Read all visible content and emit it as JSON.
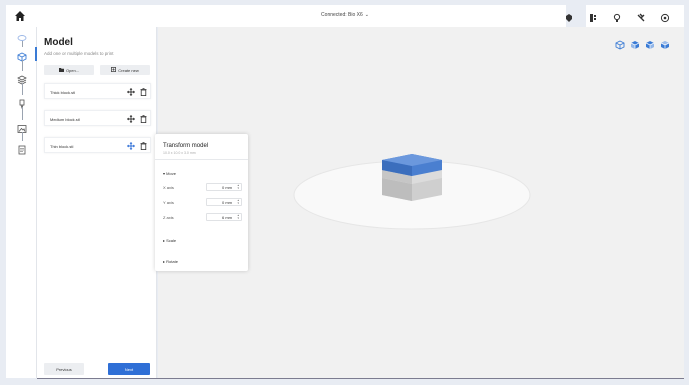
{
  "topbar": {
    "title": "Connected: Bio X6",
    "icons": [
      "home-icon",
      "printer-icon",
      "tools-icon",
      "lightbulb-icon",
      "plugins-icon",
      "settings-icon"
    ]
  },
  "rail": {
    "steps": [
      "globe-icon",
      "model-icon",
      "layers-icon",
      "extruder-icon",
      "image-icon",
      "document-icon"
    ]
  },
  "panel": {
    "title": "Model",
    "subtitle": "Add one or multiple models to print",
    "open_label": "Open...",
    "create_label": "Create new",
    "models": [
      {
        "name": "Thick block.stl"
      },
      {
        "name": "Medium block.stl"
      },
      {
        "name": "Thin block.stl"
      }
    ],
    "previous_label": "Previous",
    "next_label": "Next"
  },
  "transform": {
    "title": "Transform model",
    "subtitle": "10.0 x 10.0 x 3.0 mm",
    "move_label": "Move",
    "x_label": "X axis",
    "y_label": "Y axis",
    "z_label": "Z axis",
    "x_value": "0 mm",
    "y_value": "0 mm",
    "z_value": "6 mm",
    "scale_label": "Scale",
    "rotate_label": "Rotate"
  },
  "viewport": {
    "view_icons": [
      "view-iso-icon",
      "view-front-icon",
      "view-side-icon",
      "view-top-icon"
    ]
  },
  "colors": {
    "accent": "#2f6fd6",
    "selected_layer": "#4a7fd0",
    "background": "#e8ecf3"
  }
}
